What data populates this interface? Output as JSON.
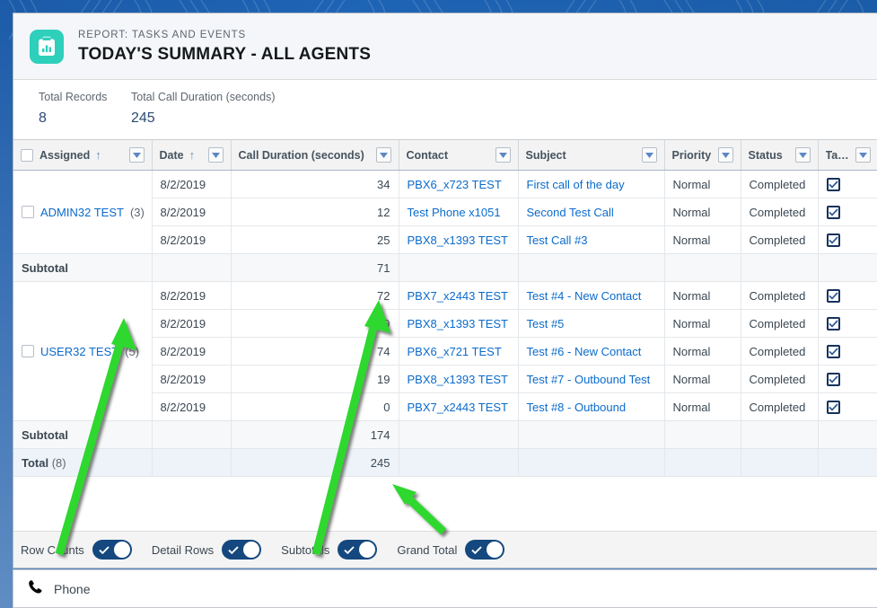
{
  "window": {
    "header": {
      "icon": "report-clipboard-chart-icon",
      "eyebrow": "REPORT: TASKS AND EVENTS",
      "title": "TODAY'S SUMMARY - ALL AGENTS",
      "icon_color": "#2ecfbb"
    },
    "summary": {
      "records_label": "Total Records",
      "records_value": "8",
      "duration_label": "Total Call Duration (seconds)",
      "duration_value": "245"
    },
    "table": {
      "columns": [
        {
          "label": "Assigned",
          "sorted": true,
          "sort_dir": "↑",
          "menu": "chevron-down-icon"
        },
        {
          "label": "Date",
          "sorted": true,
          "sort_dir": "↑",
          "menu": "chevron-down-icon"
        },
        {
          "label": "Call Duration (seconds)",
          "sorted": false,
          "sort_dir": "",
          "menu": "chevron-down-icon"
        },
        {
          "label": "Contact",
          "sorted": false,
          "sort_dir": "",
          "menu": "chevron-down-icon"
        },
        {
          "label": "Subject",
          "sorted": false,
          "sort_dir": "",
          "menu": "chevron-down-icon"
        },
        {
          "label": "Priority",
          "sorted": false,
          "sort_dir": "",
          "menu": "chevron-down-icon"
        },
        {
          "label": "Status",
          "sorted": false,
          "sort_dir": "",
          "menu": "chevron-down-icon"
        },
        {
          "label": "Task",
          "sorted": false,
          "sort_dir": "",
          "menu": "chevron-down-icon"
        }
      ],
      "groups": [
        {
          "name": "ADMIN32 TEST",
          "count": "(3)",
          "rows": [
            {
              "date": "8/2/2019",
              "duration": "34",
              "contact": "PBX6_x723 TEST",
              "subject": "First call of the day",
              "priority": "Normal",
              "status": "Completed",
              "task": true
            },
            {
              "date": "8/2/2019",
              "duration": "12",
              "contact": "Test Phone x1051",
              "subject": "Second Test Call",
              "priority": "Normal",
              "status": "Completed",
              "task": true
            },
            {
              "date": "8/2/2019",
              "duration": "25",
              "contact": "PBX8_x1393 TEST",
              "subject": "Test Call #3",
              "priority": "Normal",
              "status": "Completed",
              "task": true
            }
          ],
          "subtotal_label": "Subtotal",
          "subtotal_value": "71"
        },
        {
          "name": "USER32 TEST",
          "count": "(5)",
          "rows": [
            {
              "date": "8/2/2019",
              "duration": "72",
              "contact": "PBX7_x2443 TEST",
              "subject": "Test #4 - New Contact",
              "priority": "Normal",
              "status": "Completed",
              "task": true
            },
            {
              "date": "8/2/2019",
              "duration": "9",
              "contact": "PBX8_x1393 TEST",
              "subject": "Test #5",
              "priority": "Normal",
              "status": "Completed",
              "task": true
            },
            {
              "date": "8/2/2019",
              "duration": "74",
              "contact": "PBX6_x721 TEST",
              "subject": "Test #6 - New Contact",
              "priority": "Normal",
              "status": "Completed",
              "task": true
            },
            {
              "date": "8/2/2019",
              "duration": "19",
              "contact": "PBX8_x1393 TEST",
              "subject": "Test #7 - Outbound Test",
              "priority": "Normal",
              "status": "Completed",
              "task": true
            },
            {
              "date": "8/2/2019",
              "duration": "0",
              "contact": "PBX7_x2443 TEST",
              "subject": "Test #8 - Outbound",
              "priority": "Normal",
              "status": "Completed",
              "task": true
            }
          ],
          "subtotal_label": "Subtotal",
          "subtotal_value": "174"
        }
      ],
      "total": {
        "label": "Total",
        "count": "(8)",
        "value": "245"
      }
    },
    "toggles": [
      {
        "label": "Row Counts",
        "on": true
      },
      {
        "label": "Detail Rows",
        "on": true
      },
      {
        "label": "Subtotals",
        "on": true
      },
      {
        "label": "Grand Total",
        "on": true
      }
    ]
  },
  "utility_bar": {
    "icon": "phone-icon",
    "label": "Phone"
  },
  "colors": {
    "link": "#0b6bcb",
    "brand_blue": "#1a5ca8",
    "toggle_on": "#14487f",
    "icon_teal": "#2ecfbb",
    "annotation_green": "#2fd82f"
  }
}
